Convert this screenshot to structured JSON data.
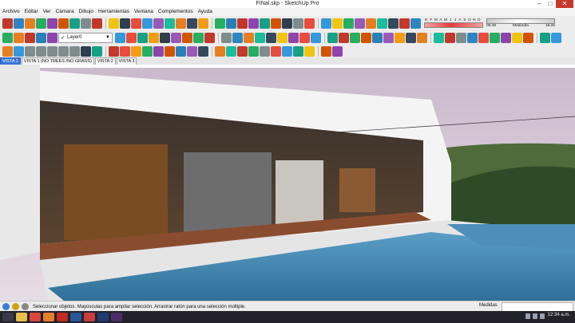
{
  "window": {
    "title": "FINal.skp - SketchUp Pro"
  },
  "window_buttons": [
    {
      "name": "minimize-button",
      "glyph": "–"
    },
    {
      "name": "maximize-button",
      "glyph": "□"
    },
    {
      "name": "close-button",
      "glyph": "✕"
    }
  ],
  "menu": [
    "Archivo",
    "Editar",
    "Ver",
    "Cámara",
    "Dibujo",
    "Herramientas",
    "Ventana",
    "Complementos",
    "Ayuda"
  ],
  "layer": {
    "value": "Layer0",
    "check": "✓"
  },
  "shadows": {
    "months": [
      "E",
      "F",
      "M",
      "A",
      "M",
      "J",
      "J",
      "A",
      "S",
      "O",
      "N",
      "D"
    ],
    "time_start": "06:48",
    "time_mid": "Mediodía",
    "time_end": "16:25"
  },
  "tabs": [
    "VISTA 1",
    "VISTA 1 (NO TREES /NO GRASS)",
    "VISTA 2",
    "VISTA 3"
  ],
  "status": {
    "text": "Seleccionar objetos. Mayúsculas para ampliar selección. Arrastrar ratón para una selección múltiple.",
    "measures_label": "Medidas",
    "measures_value": ""
  },
  "taskbar": {
    "time": "12:34 a.m."
  },
  "toolbar_colors": {
    "row1": [
      "#c0392b",
      "#2e86c1",
      "#e67e22",
      "#27ae60",
      "#8e44ad",
      "#d35400",
      "#16a085",
      "#7f8c8d",
      "#c0392b",
      "#f1c40f",
      "#2c3e50",
      "#e74c3c",
      "#3498db",
      "#9b59b6",
      "#1abc9c",
      "#e67e22",
      "#34495e",
      "#f39c12",
      "#27ae60",
      "#2980b9",
      "#c0392b",
      "#8e44ad",
      "#16a085",
      "#d35400",
      "#2c3e50",
      "#7f8c8d",
      "#e74c3c",
      "#3498db",
      "#f1c40f",
      "#27ae60",
      "#9b59b6",
      "#e67e22",
      "#1abc9c",
      "#34495e",
      "#c0392b",
      "#2e86c1"
    ],
    "row2a": [
      "#27ae60",
      "#e67e22",
      "#c0392b",
      "#2980b9",
      "#8e44ad"
    ],
    "row2b": [
      "#3498db",
      "#e74c3c",
      "#16a085",
      "#f39c12",
      "#2c3e50",
      "#9b59b6",
      "#d35400",
      "#27ae60",
      "#c0392b",
      "#7f8c8d",
      "#2e86c1",
      "#e67e22",
      "#1abc9c",
      "#34495e",
      "#f1c40f",
      "#8e44ad",
      "#e74c3c",
      "#3498db",
      "#16a085",
      "#c0392b",
      "#27ae60",
      "#d35400",
      "#2980b9",
      "#9b59b6",
      "#f39c12",
      "#34495e",
      "#e67e22",
      "#1abc9c",
      "#c0392b",
      "#7f8c8d",
      "#2e86c1",
      "#e74c3c",
      "#27ae60",
      "#8e44ad",
      "#f1c40f",
      "#d35400",
      "#16a085",
      "#3498db"
    ],
    "row3": [
      "#e67e22",
      "#3498db",
      "#7f8c8d",
      "#7f8c8d",
      "#7f8c8d",
      "#7f8c8d",
      "#7f8c8d",
      "#2c3e50",
      "#16a085",
      "#c0392b",
      "#e74c3c",
      "#f39c12",
      "#27ae60",
      "#8e44ad",
      "#d35400",
      "#2980b9",
      "#9b59b6",
      "#34495e",
      "#e67e22",
      "#1abc9c",
      "#c0392b",
      "#27ae60",
      "#7f8c8d",
      "#e74c3c",
      "#3498db",
      "#16a085",
      "#f1c40f",
      "#d35400",
      "#8e44ad"
    ]
  }
}
